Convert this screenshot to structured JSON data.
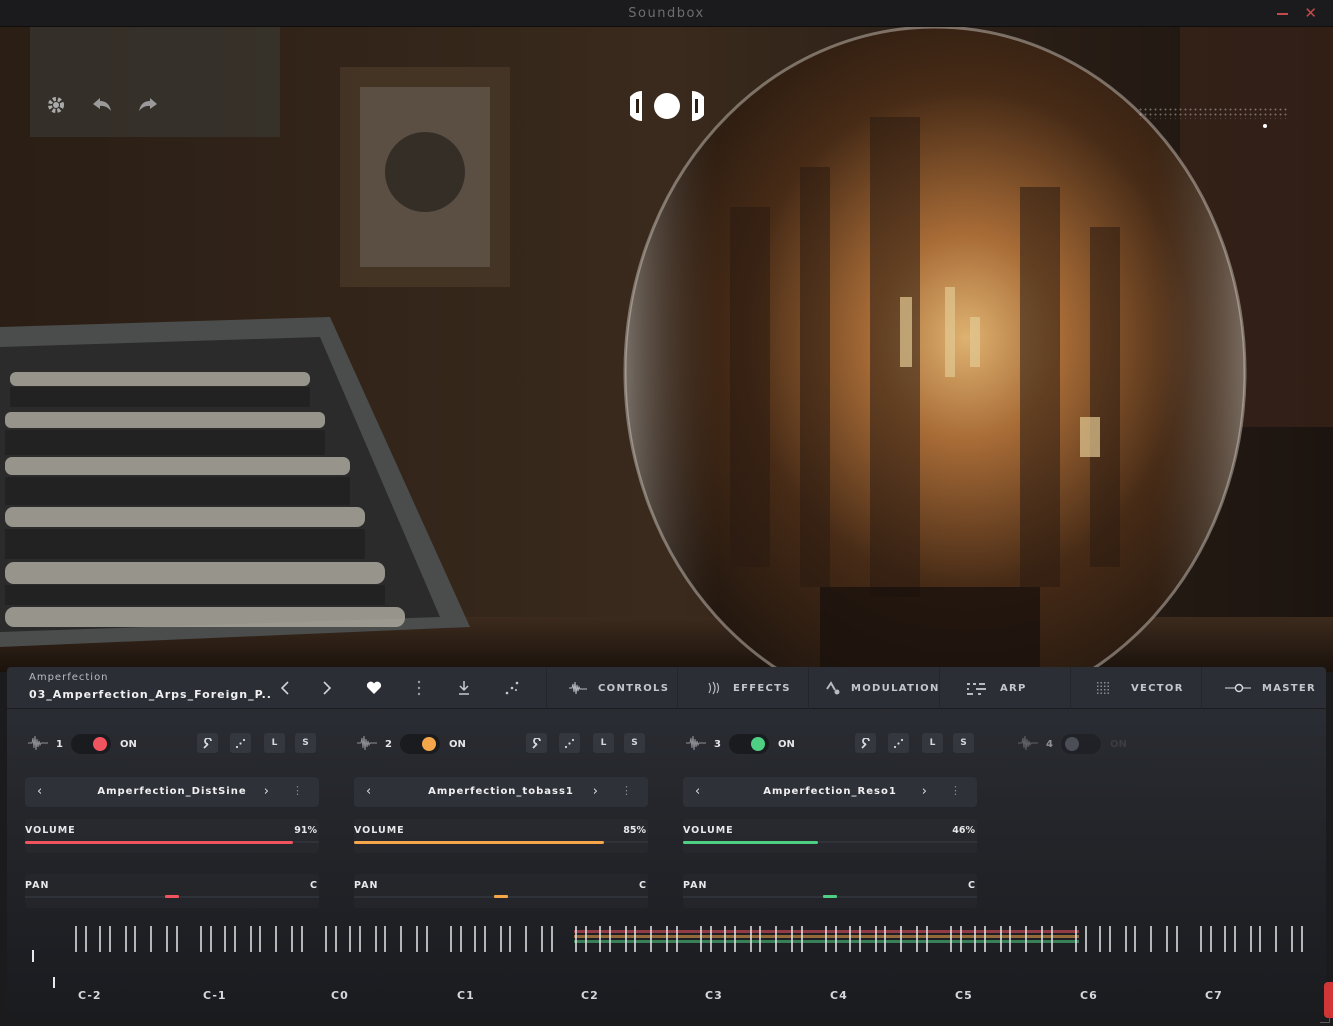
{
  "window": {
    "title": "Soundbox"
  },
  "header": {
    "icons": [
      "gear-icon",
      "undo-icon",
      "redo-icon"
    ],
    "logo": "soundbox-logo"
  },
  "preset": {
    "bank": "Amperfection",
    "name": "03_Amperfection_Arps_Foreign_P.."
  },
  "tabs": [
    {
      "label": "CONTROLS",
      "icon": "waveform-icon"
    },
    {
      "label": "EFFECTS",
      "icon": "effects-icon"
    },
    {
      "label": "MODULATION",
      "icon": "modulation-icon"
    },
    {
      "label": "ARP",
      "icon": "arp-icon"
    },
    {
      "label": "VECTOR",
      "icon": "vector-icon"
    },
    {
      "label": "MASTER",
      "icon": "master-icon"
    }
  ],
  "layers": [
    {
      "num": "1",
      "on_label": "ON",
      "on": true,
      "color": "#f0545e",
      "sample": "Amperfection_DistSine",
      "volume_label": "VOLUME",
      "volume": "91%",
      "volume_frac": 0.91,
      "pan_label": "PAN",
      "pan": "C",
      "pan_frac": 0.5,
      "solo_labels": [
        "L",
        "S"
      ]
    },
    {
      "num": "2",
      "on_label": "ON",
      "on": true,
      "color": "#f5a54a",
      "sample": "Amperfection_tobass1",
      "volume_label": "VOLUME",
      "volume": "85%",
      "volume_frac": 0.85,
      "pan_label": "PAN",
      "pan": "C",
      "pan_frac": 0.5,
      "solo_labels": [
        "L",
        "S"
      ]
    },
    {
      "num": "3",
      "on_label": "ON",
      "on": true,
      "color": "#4fcf84",
      "sample": "Amperfection_Reso1",
      "volume_label": "VOLUME",
      "volume": "46%",
      "volume_frac": 0.46,
      "pan_label": "PAN",
      "pan": "C",
      "pan_frac": 0.5,
      "solo_labels": [
        "L",
        "S"
      ]
    },
    {
      "num": "4",
      "on_label": "ON",
      "on": false,
      "color": "#6a6c78"
    }
  ],
  "keyboard": {
    "octaves": [
      "C-2",
      "C-1",
      "C0",
      "C1",
      "C2",
      "C3",
      "C4",
      "C5",
      "C6",
      "C7"
    ]
  }
}
